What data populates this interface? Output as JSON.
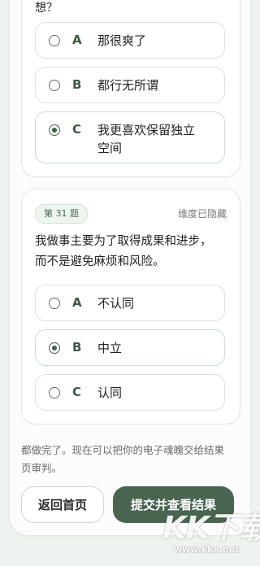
{
  "prev_question": {
    "tail_text": "想？",
    "options": [
      {
        "letter": "A",
        "text": "那很爽了",
        "selected": false
      },
      {
        "letter": "B",
        "text": "都行无所谓",
        "selected": false
      },
      {
        "letter": "C",
        "text_line1": "我更喜欢保留独立",
        "text_line2": "空间",
        "selected": true
      }
    ]
  },
  "question": {
    "badge": "第 31 题",
    "dimension_status": "维度已隐藏",
    "text_line1": "我做事主要为了取得成果和进步，",
    "text_line2": "而不是避免麻烦和风险。",
    "options": [
      {
        "letter": "A",
        "text": "不认同",
        "selected": false
      },
      {
        "letter": "B",
        "text": "中立",
        "selected": true
      },
      {
        "letter": "C",
        "text": "认同",
        "selected": false
      }
    ]
  },
  "footer": {
    "note_line1": "都做完了。现在可以把你的电子魂魄交给结果",
    "note_line2": "页审判。",
    "home_button": "返回首页",
    "submit_button": "提交并查看结果"
  },
  "watermark": {
    "logo": "KK下载",
    "url": "www.kkx.net"
  },
  "colors": {
    "accent": "#47654f",
    "background": "#eef3ef",
    "card": "#ffffff"
  }
}
